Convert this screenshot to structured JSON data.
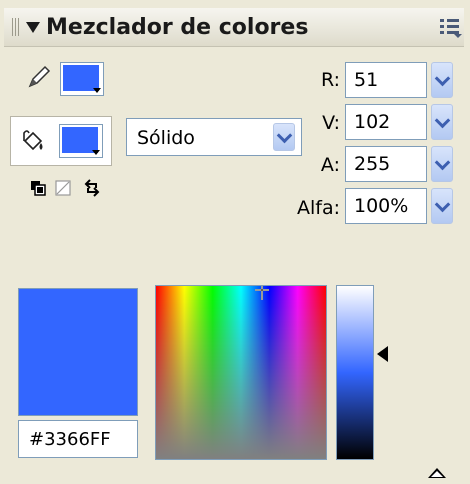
{
  "panel": {
    "title": "Mezclador de colores",
    "icons": {
      "grip": "grip-icon",
      "collapse": "triangle-down-icon",
      "menu": "panel-menu-icon"
    }
  },
  "tools": {
    "stroke": {
      "icon": "pencil-icon",
      "color": "#3366ff"
    },
    "fill": {
      "icon": "paint-bucket-icon",
      "color": "#3366ff"
    },
    "small_icons": [
      "black-white-icon",
      "no-color-icon",
      "swap-colors-icon"
    ]
  },
  "fill_type": {
    "selected": "Sólido"
  },
  "fields": [
    {
      "label": "R:",
      "value": "51"
    },
    {
      "label": "V:",
      "value": "102"
    },
    {
      "label": "A:",
      "value": "255"
    },
    {
      "label": "Alfa:",
      "value": "100%"
    }
  ],
  "preview": {
    "color": "#3366ff",
    "hex": "#3366FF"
  },
  "colors": {
    "accent": "#3366ff",
    "panel_bg": "#ece9d8",
    "field_border": "#7f9db9"
  },
  "footer": {
    "collapse_icon": "collapse-up-icon"
  }
}
